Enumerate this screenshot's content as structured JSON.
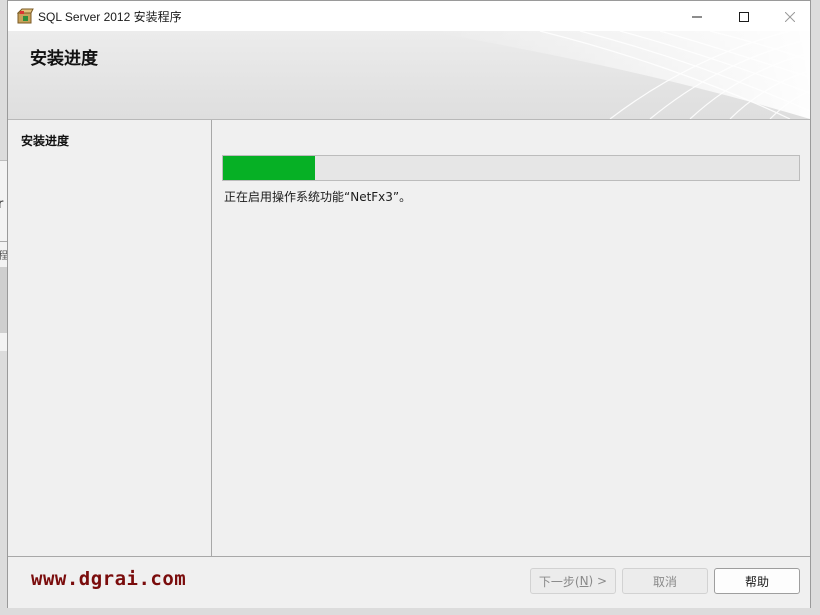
{
  "window": {
    "title": "SQL Server 2012 安装程序"
  },
  "banner": {
    "title": "安装进度"
  },
  "sidebar": {
    "items": [
      {
        "label": "安装进度"
      }
    ]
  },
  "progress": {
    "fraction": 0.16,
    "status_text": "正在启用操作系统功能“NetFx3”。",
    "color": "#06b025"
  },
  "footer": {
    "watermark": "www.dgrai.com",
    "next_label_prefix": "下一步(",
    "next_accel": "N",
    "next_label_suffix": ") >",
    "cancel_label": "取消",
    "help_label": "帮助"
  },
  "background_window": {
    "fragment_1": "r",
    "fragment_2": "程"
  },
  "icons": {
    "app": "sql-setup-box-icon",
    "minimize": "minimize-icon",
    "maximize": "maximize-icon",
    "close": "close-icon"
  }
}
